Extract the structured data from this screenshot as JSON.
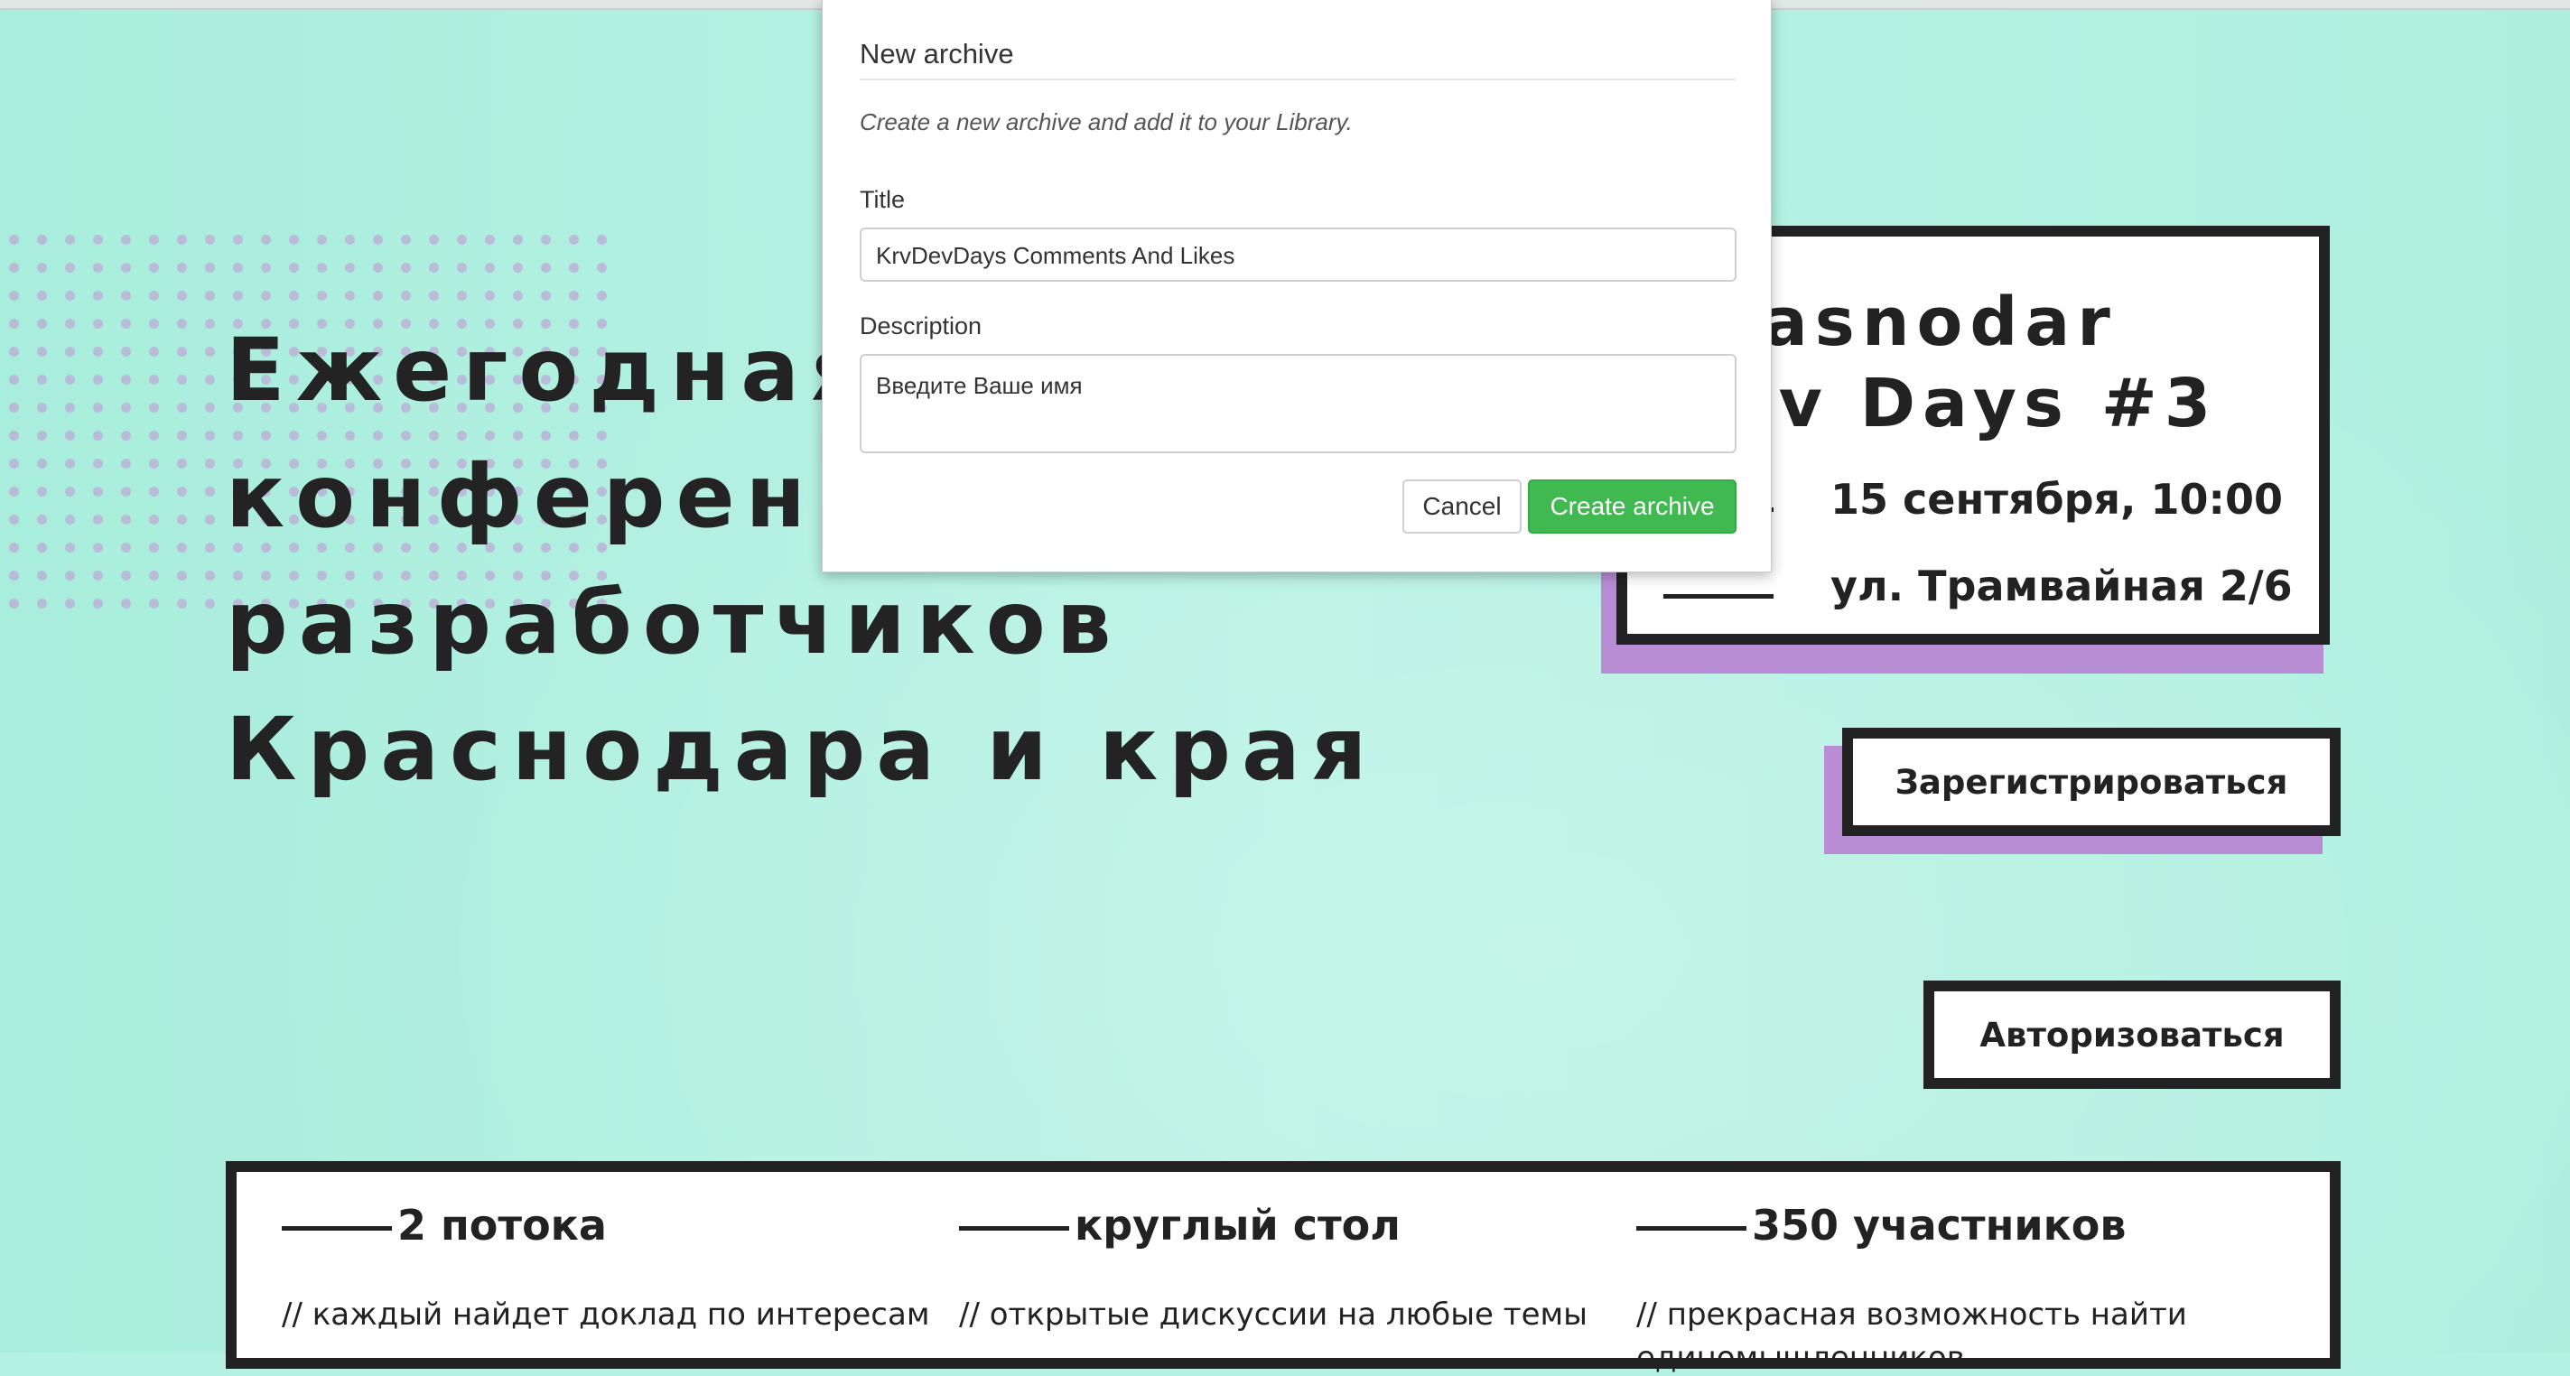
{
  "hero": {
    "lines": [
      "Ежегодная конференция",
      "конференция",
      "разработчиков",
      "Краснодара и края"
    ]
  },
  "info": {
    "name_line1": "Krasnodar",
    "name_line2": "Dev Days #3",
    "date": "15 сентября, 10:00",
    "address": "ул. Трамвайная 2/6"
  },
  "buttons": {
    "register": "Зарегистрироваться",
    "login": "Авторизоваться"
  },
  "features": [
    {
      "title": "2 потока",
      "desc": "// каждый найдет доклад по интересам",
      "desc2": ""
    },
    {
      "title": "круглый стол",
      "desc": "// открытые дискуссии на любые темы",
      "desc2": ""
    },
    {
      "title": "350 участников",
      "desc": "// прекрасная возможность найти",
      "desc2": "единомышленников"
    }
  ],
  "modal": {
    "title": "New archive",
    "subtitle": "Create a new archive and add it to your Library.",
    "title_label": "Title",
    "title_value": "KrvDevDays Comments And Likes",
    "description_label": "Description",
    "description_value": "Введите Ваше имя",
    "cancel": "Cancel",
    "create": "Create archive"
  },
  "colors": {
    "background": "#b5f1e2",
    "accent_purple": "#b98dd4",
    "dark": "#222222",
    "create_green": "#3fb950"
  }
}
